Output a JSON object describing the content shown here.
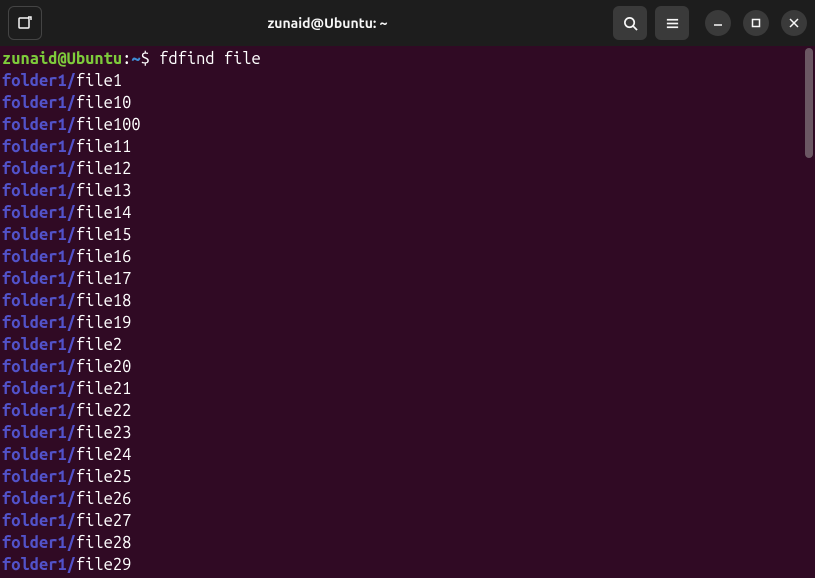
{
  "titlebar": {
    "title": "zunaid@Ubuntu: ~"
  },
  "prompt": {
    "user_host": "zunaid@Ubuntu",
    "sep": ":",
    "path": "~",
    "dollar": "$ ",
    "command": "fdfind file"
  },
  "results": [
    {
      "folder": "folder1/",
      "file": "file1"
    },
    {
      "folder": "folder1/",
      "file": "file10"
    },
    {
      "folder": "folder1/",
      "file": "file100"
    },
    {
      "folder": "folder1/",
      "file": "file11"
    },
    {
      "folder": "folder1/",
      "file": "file12"
    },
    {
      "folder": "folder1/",
      "file": "file13"
    },
    {
      "folder": "folder1/",
      "file": "file14"
    },
    {
      "folder": "folder1/",
      "file": "file15"
    },
    {
      "folder": "folder1/",
      "file": "file16"
    },
    {
      "folder": "folder1/",
      "file": "file17"
    },
    {
      "folder": "folder1/",
      "file": "file18"
    },
    {
      "folder": "folder1/",
      "file": "file19"
    },
    {
      "folder": "folder1/",
      "file": "file2"
    },
    {
      "folder": "folder1/",
      "file": "file20"
    },
    {
      "folder": "folder1/",
      "file": "file21"
    },
    {
      "folder": "folder1/",
      "file": "file22"
    },
    {
      "folder": "folder1/",
      "file": "file23"
    },
    {
      "folder": "folder1/",
      "file": "file24"
    },
    {
      "folder": "folder1/",
      "file": "file25"
    },
    {
      "folder": "folder1/",
      "file": "file26"
    },
    {
      "folder": "folder1/",
      "file": "file27"
    },
    {
      "folder": "folder1/",
      "file": "file28"
    },
    {
      "folder": "folder1/",
      "file": "file29"
    }
  ]
}
